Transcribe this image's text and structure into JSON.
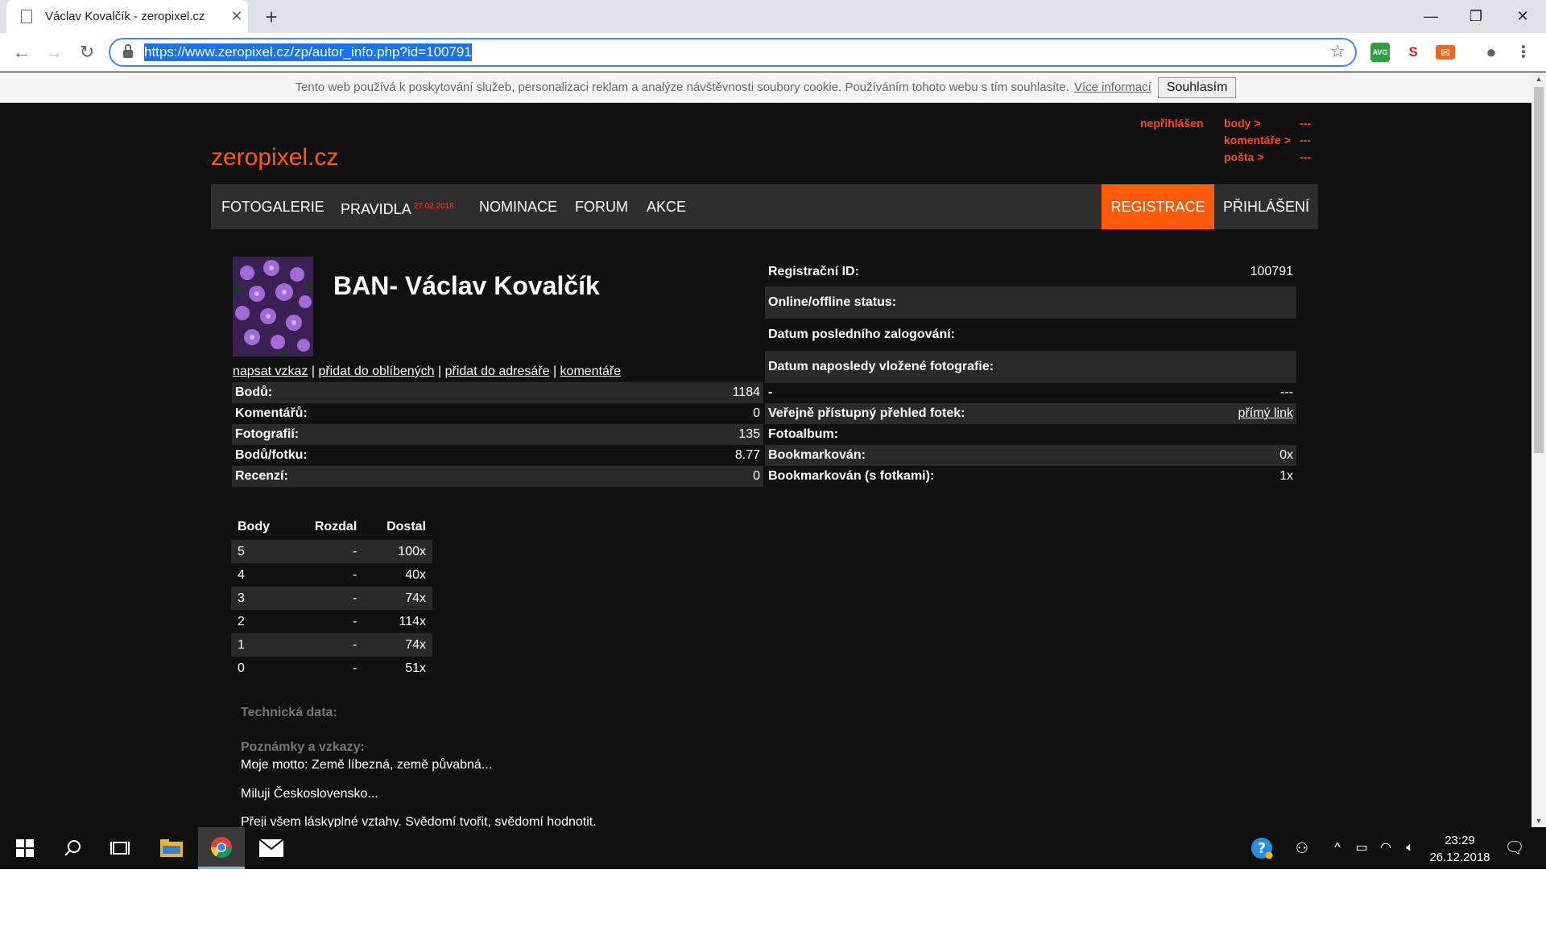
{
  "browser": {
    "tab_title": "Václav Kovalčík - zeropixel.cz",
    "url": "https://www.zeropixel.cz/zp/autor_info.php?id=100791"
  },
  "cookie": {
    "text": "Tento web používá k poskytování služeb, personalizaci reklam a analýze návštěvnosti soubory cookie. Používáním tohoto webu s tím souhlasíte.",
    "link": "Více informací",
    "button": "Souhlasím"
  },
  "site": {
    "logo": "zeropixel.cz",
    "status": "nepřihlášen",
    "body_label": "body >",
    "body_value": "---",
    "komentare_label": "komentáře >",
    "komentare_value": "---",
    "posta_label": "pošta >",
    "posta_value": "---"
  },
  "nav": {
    "fotogalerie": "FOTOGALERIE",
    "pravidla": "PRAVIDLA",
    "pravidla_date": "27.02.2018",
    "nominace": "NOMINACE",
    "forum": "FORUM",
    "akce": "AKCE",
    "registrace": "REGISTRACE",
    "prihlaseni": "PŘIHLÁŠENÍ"
  },
  "profile": {
    "name": "BAN- Václav Kovalčík",
    "link_vzkaz": "napsat vzkaz",
    "link_oblibene": "přidat do oblíbených",
    "link_adresar": "přidat do adresáře",
    "link_komentare": "komentáře",
    "sep": "|"
  },
  "stats_left": [
    {
      "label": "Bodů:",
      "value": "1184"
    },
    {
      "label": "Komentářů:",
      "value": "0"
    },
    {
      "label": "Fotografií:",
      "value": "135"
    },
    {
      "label": "Bodů/fotku:",
      "value": "8.77"
    },
    {
      "label": "Recenzí:",
      "value": "0"
    }
  ],
  "stats_right_top": [
    {
      "label": "Registrační ID:",
      "value": "100791"
    },
    {
      "label": "Online/offline status:",
      "value": ""
    },
    {
      "label": "Datum posledního zalogování:",
      "value": ""
    },
    {
      "label": "Datum naposledy vložené fotografie:",
      "value": ""
    }
  ],
  "stats_right": [
    {
      "label": "-",
      "value": "---"
    },
    {
      "label": "Veřejně přístupný přehled fotek:",
      "value": "přímý link"
    },
    {
      "label": "Fotoalbum:",
      "value": ""
    },
    {
      "label": "Bookmarkován:",
      "value": "0x"
    },
    {
      "label": "Bookmarkován (s fotkami):",
      "value": "1x"
    }
  ],
  "votes": {
    "headers": [
      "Body",
      "Rozdal",
      "Dostal"
    ],
    "rows": [
      [
        "5",
        "-",
        "100x"
      ],
      [
        "4",
        "-",
        "40x"
      ],
      [
        "3",
        "-",
        "74x"
      ],
      [
        "2",
        "-",
        "114x"
      ],
      [
        "1",
        "-",
        "74x"
      ],
      [
        "0",
        "-",
        "51x"
      ]
    ]
  },
  "notes": {
    "tech_title": "Technická data:",
    "notes_title": "Poznámky a vzkazy:",
    "line1": "Moje motto: Země líbezná, země půvabná...",
    "line2": "Miluji Československo...",
    "line3": "Přeji všem láskyplné vztahy. Svědomí tvořit, svědomí hodnotit."
  },
  "taskbar": {
    "time": "23:29",
    "date": "26.12.2018"
  },
  "colors": {
    "accent": "#ff5a0a",
    "page_bg": "#111111",
    "nav_bg": "#2e2e2e"
  }
}
